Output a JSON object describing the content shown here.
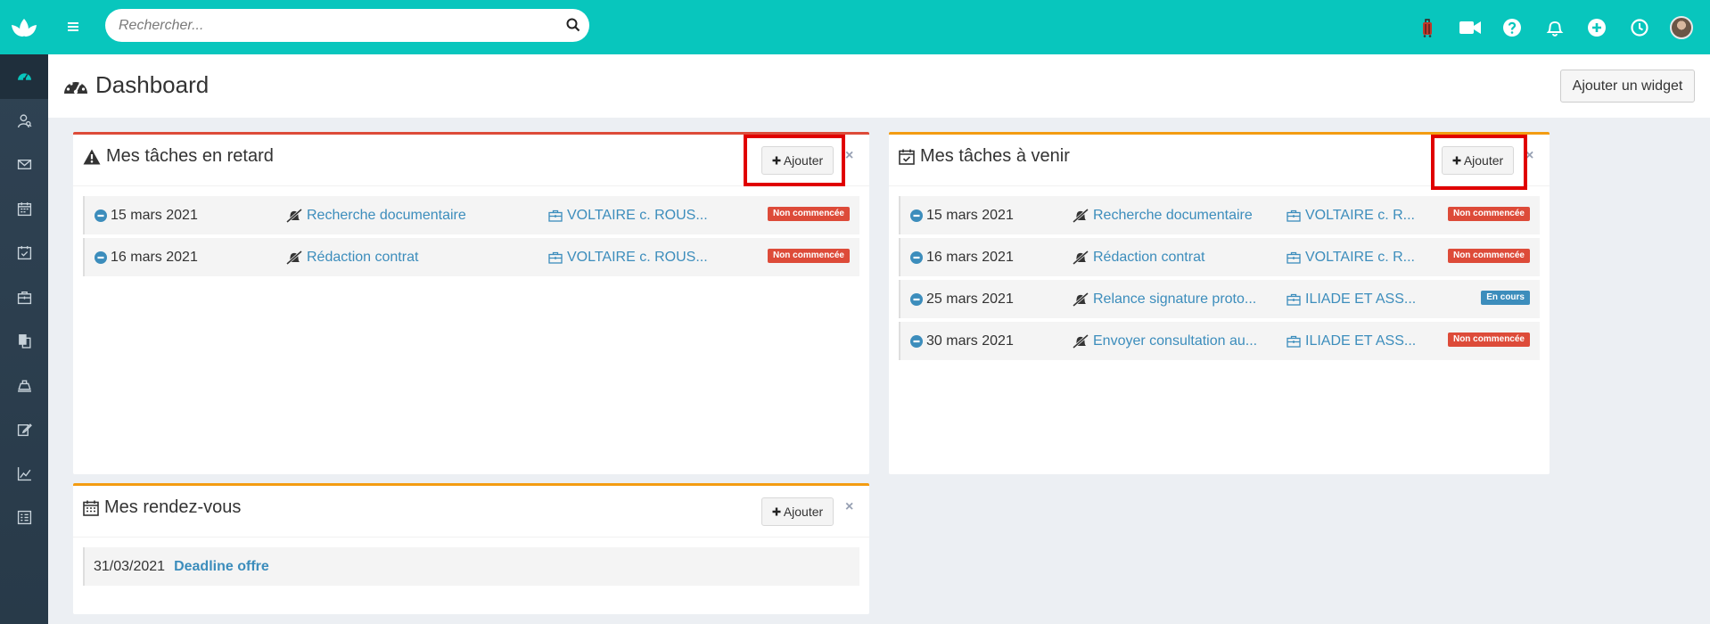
{
  "search": {
    "placeholder": "Rechercher..."
  },
  "colors": {
    "brand": "#08c6bd",
    "sidebar": "#2d3e4f",
    "link": "#3c8dbc",
    "danger": "#dd4b39",
    "warning": "#f39c12",
    "info": "#3c8dbc"
  },
  "topbar": {
    "icons": [
      "suitcase-icon",
      "video-camera-icon",
      "help-icon",
      "bell-icon",
      "plus-circle-icon",
      "clock-icon",
      "user-avatar"
    ]
  },
  "sidebar": {
    "items": [
      "dashboard-icon",
      "contacts-icon",
      "mail-icon",
      "calendar-icon",
      "tasks-icon",
      "cases-icon",
      "documents-icon",
      "billing-icon",
      "edit-icon",
      "stats-icon",
      "forms-icon"
    ]
  },
  "header": {
    "title": "Dashboard",
    "add_widget_label": "Ajouter un widget"
  },
  "widgets": {
    "overdue": {
      "title": "Mes tâches en retard",
      "add_label": "Ajouter",
      "close": "×",
      "rows": [
        {
          "date": "15 mars 2021",
          "task": "Recherche documentaire",
          "case": "VOLTAIRE c. ROUS...",
          "status": "Non commencée"
        },
        {
          "date": "16 mars 2021",
          "task": "Rédaction contrat",
          "case": "VOLTAIRE c. ROUS...",
          "status": "Non commencée"
        }
      ]
    },
    "upcoming": {
      "title": "Mes tâches à venir",
      "add_label": "Ajouter",
      "close": "×",
      "rows": [
        {
          "date": "15 mars 2021",
          "task": "Recherche documentaire",
          "case": "VOLTAIRE c. R...",
          "status": "Non commencée"
        },
        {
          "date": "16 mars 2021",
          "task": "Rédaction contrat",
          "case": "VOLTAIRE c. R...",
          "status": "Non commencée"
        },
        {
          "date": "25 mars 2021",
          "task": "Relance signature proto...",
          "case": "ILIADE ET ASS...",
          "status": "En cours"
        },
        {
          "date": "30 mars 2021",
          "task": "Envoyer consultation au...",
          "case": "ILIADE ET ASS...",
          "status": "Non commencée"
        }
      ]
    },
    "appointments": {
      "title": "Mes rendez-vous",
      "add_label": "Ajouter",
      "close": "×",
      "rows": [
        {
          "date": "31/03/2021",
          "title": "Deadline offre"
        }
      ]
    }
  }
}
